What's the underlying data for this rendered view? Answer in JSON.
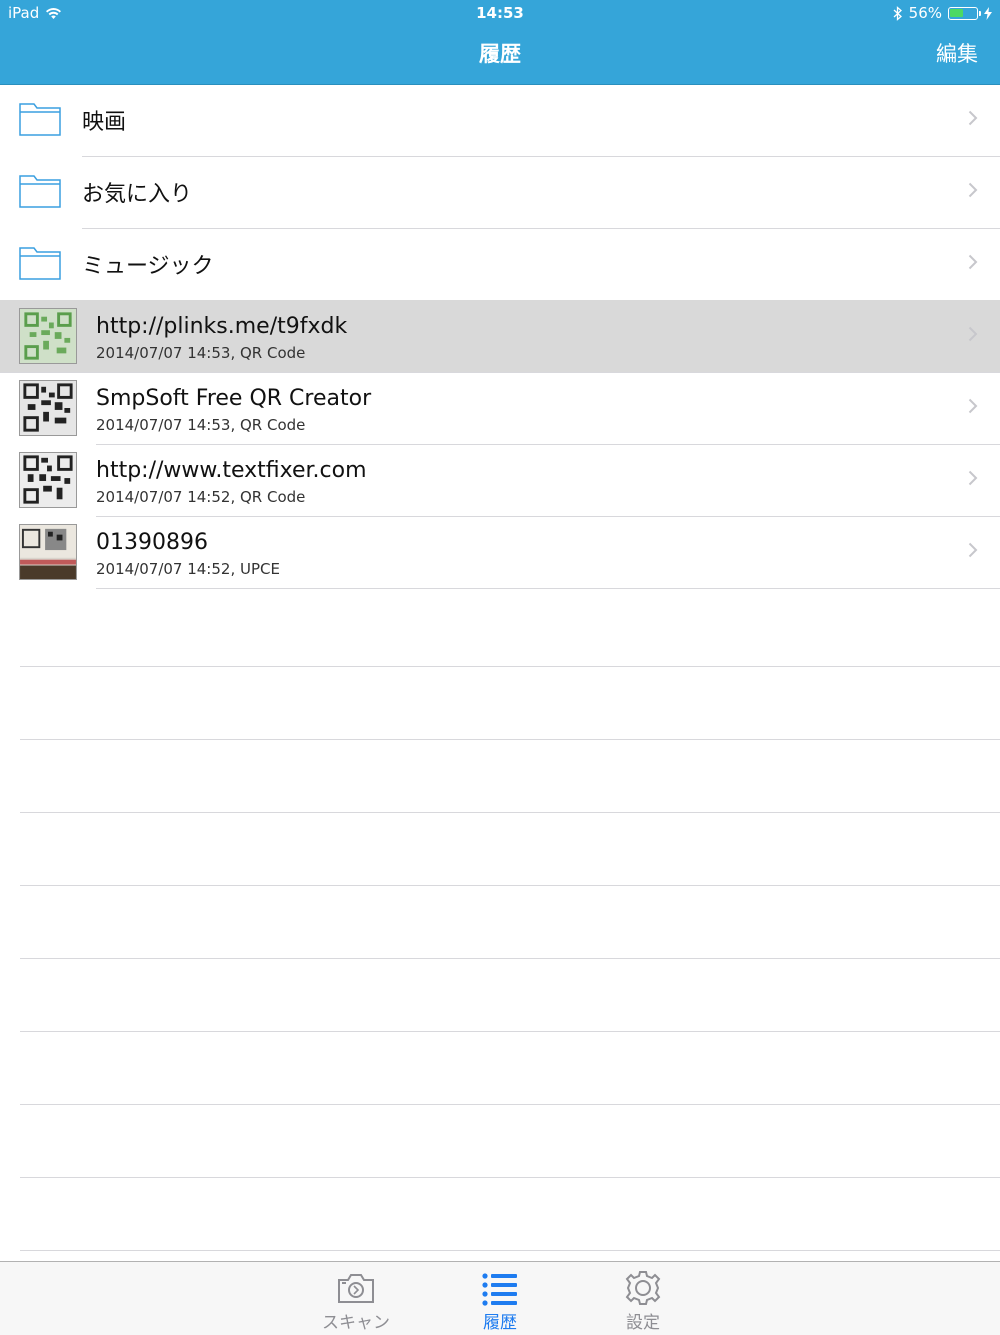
{
  "status_bar": {
    "device": "iPad",
    "time": "14:53",
    "battery": "56%",
    "battery_level": 0.56
  },
  "nav": {
    "title": "履歴",
    "edit_label": "編集"
  },
  "folders": [
    {
      "name": "映画"
    },
    {
      "name": "お気に入り"
    },
    {
      "name": "ミュージック"
    }
  ],
  "items": [
    {
      "title": "http://plinks.me/t9fxdk",
      "subtitle": "2014/07/07 14:53,  QR Code"
    },
    {
      "title": "SmpSoft Free QR Creator",
      "subtitle": "2014/07/07 14:53,  QR Code"
    },
    {
      "title": "http://www.textfixer.com",
      "subtitle": "2014/07/07 14:52,  QR Code"
    },
    {
      "title": "01390896",
      "subtitle": "2014/07/07 14:52,  UPCE"
    }
  ],
  "tabbar": {
    "scan_label": "スキャン",
    "history_label": "履歴",
    "settings_label": "設定"
  },
  "colors": {
    "accent": "#35a5d9",
    "tab_active": "#1e7cf0",
    "folder_icon": "#3a9fe0",
    "selected_row": "#d9d9d9"
  }
}
